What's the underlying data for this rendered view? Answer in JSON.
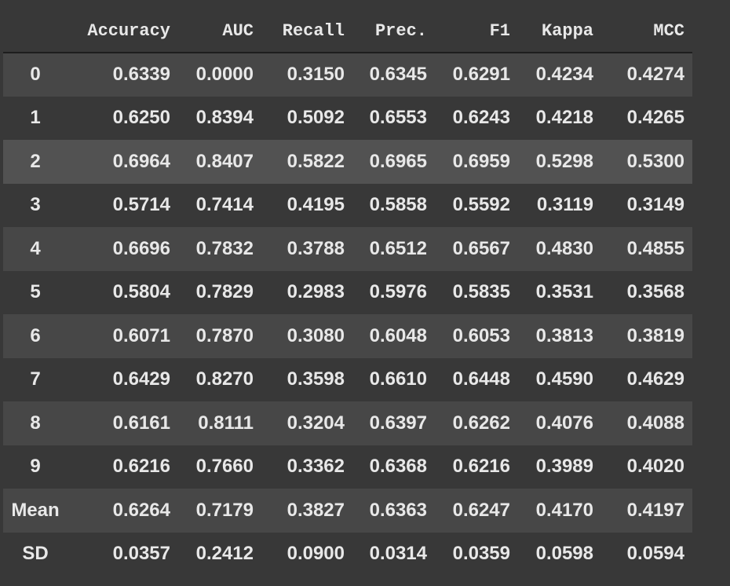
{
  "table": {
    "columns": [
      "",
      "Accuracy",
      "AUC",
      "Recall",
      "Prec.",
      "F1",
      "Kappa",
      "MCC"
    ],
    "rows": [
      {
        "index": "0",
        "values": [
          "0.6339",
          "0.0000",
          "0.3150",
          "0.6345",
          "0.6291",
          "0.4234",
          "0.4274"
        ]
      },
      {
        "index": "1",
        "values": [
          "0.6250",
          "0.8394",
          "0.5092",
          "0.6553",
          "0.6243",
          "0.4218",
          "0.4265"
        ]
      },
      {
        "index": "2",
        "values": [
          "0.6964",
          "0.8407",
          "0.5822",
          "0.6965",
          "0.6959",
          "0.5298",
          "0.5300"
        ]
      },
      {
        "index": "3",
        "values": [
          "0.5714",
          "0.7414",
          "0.4195",
          "0.5858",
          "0.5592",
          "0.3119",
          "0.3149"
        ]
      },
      {
        "index": "4",
        "values": [
          "0.6696",
          "0.7832",
          "0.3788",
          "0.6512",
          "0.6567",
          "0.4830",
          "0.4855"
        ]
      },
      {
        "index": "5",
        "values": [
          "0.5804",
          "0.7829",
          "0.2983",
          "0.5976",
          "0.5835",
          "0.3531",
          "0.3568"
        ]
      },
      {
        "index": "6",
        "values": [
          "0.6071",
          "0.7870",
          "0.3080",
          "0.6048",
          "0.6053",
          "0.3813",
          "0.3819"
        ]
      },
      {
        "index": "7",
        "values": [
          "0.6429",
          "0.8270",
          "0.3598",
          "0.6610",
          "0.6448",
          "0.4590",
          "0.4629"
        ]
      },
      {
        "index": "8",
        "values": [
          "0.6161",
          "0.8111",
          "0.3204",
          "0.6397",
          "0.6262",
          "0.4076",
          "0.4088"
        ]
      },
      {
        "index": "9",
        "values": [
          "0.6216",
          "0.7660",
          "0.3362",
          "0.6368",
          "0.6216",
          "0.3989",
          "0.4020"
        ]
      },
      {
        "index": "Mean",
        "values": [
          "0.6264",
          "0.7179",
          "0.3827",
          "0.6363",
          "0.6247",
          "0.4170",
          "0.4197"
        ]
      },
      {
        "index": "SD",
        "values": [
          "0.0357",
          "0.2412",
          "0.0900",
          "0.0314",
          "0.0359",
          "0.0598",
          "0.0594"
        ]
      }
    ],
    "highlighted_row": 2
  },
  "colors": {
    "background": "#383838",
    "row_stripe": "#474747",
    "row_hover": "#525252",
    "text": "#e8e8e8"
  }
}
